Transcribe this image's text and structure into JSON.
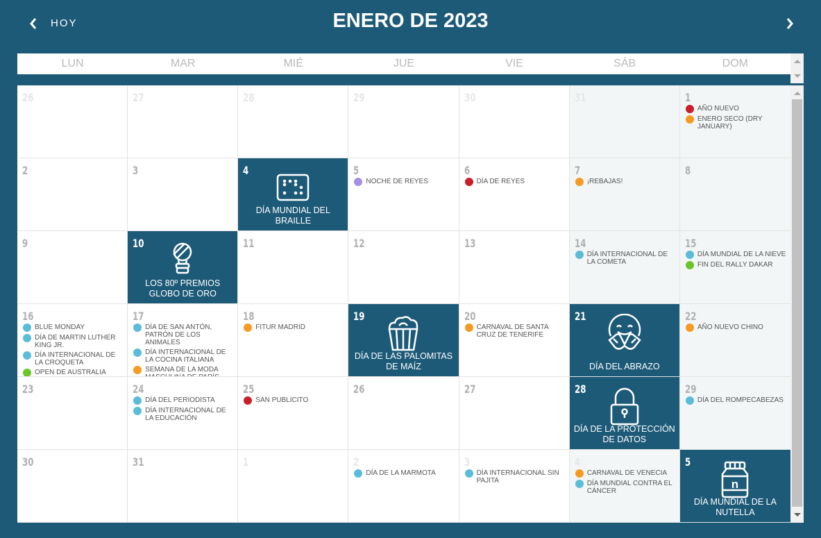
{
  "header": {
    "today_label": "HOY",
    "month_title": "ENERO DE 2023",
    "prev_icon": "chevron-left-icon",
    "next_icon": "chevron-right-icon"
  },
  "colors": {
    "brand": "#1d5a78",
    "red": "#c8202a",
    "orange": "#f59b23",
    "blue": "#5bbcd8",
    "green": "#6cc42b",
    "purple": "#a68fe3"
  },
  "weekdays": [
    "LUN",
    "MAR",
    "MIÉ",
    "JUE",
    "VIE",
    "SÁB",
    "DOM"
  ],
  "days": [
    {
      "num": "26",
      "other": true,
      "events": []
    },
    {
      "num": "27",
      "other": true,
      "events": []
    },
    {
      "num": "28",
      "other": true,
      "events": []
    },
    {
      "num": "29",
      "other": true,
      "events": []
    },
    {
      "num": "30",
      "other": true,
      "events": []
    },
    {
      "num": "31",
      "other": true,
      "weekend": true,
      "events": []
    },
    {
      "num": "1",
      "weekend": true,
      "events": [
        {
          "label": "AÑO NUEVO",
          "color": "red"
        },
        {
          "label": "ENERO SECO (DRY JANUARY)",
          "color": "orange"
        }
      ]
    },
    {
      "num": "2",
      "events": []
    },
    {
      "num": "3",
      "events": []
    },
    {
      "num": "4",
      "featured": {
        "label": "DÍA MUNDIAL DEL BRAILLE",
        "icon": "braille-icon"
      },
      "events": []
    },
    {
      "num": "5",
      "events": [
        {
          "label": "NOCHE DE REYES",
          "color": "purple"
        }
      ]
    },
    {
      "num": "6",
      "events": [
        {
          "label": "DÍA DE REYES",
          "color": "red"
        }
      ]
    },
    {
      "num": "7",
      "weekend": true,
      "events": [
        {
          "label": "¡REBAJAS!",
          "color": "orange"
        }
      ]
    },
    {
      "num": "8",
      "weekend": true,
      "events": []
    },
    {
      "num": "9",
      "events": []
    },
    {
      "num": "10",
      "featured": {
        "label": "LOS 80º PREMIOS GLOBO DE ORO",
        "icon": "golden-globe-icon"
      },
      "events": []
    },
    {
      "num": "11",
      "events": []
    },
    {
      "num": "12",
      "events": []
    },
    {
      "num": "13",
      "events": []
    },
    {
      "num": "14",
      "weekend": true,
      "events": [
        {
          "label": "DÍA INTERNACIONAL DE LA COMETA",
          "color": "blue"
        }
      ]
    },
    {
      "num": "15",
      "weekend": true,
      "events": [
        {
          "label": "DÍA MUNDIAL DE LA NIEVE",
          "color": "blue"
        },
        {
          "label": "FIN DEL RALLY DAKAR",
          "color": "green"
        }
      ]
    },
    {
      "num": "16",
      "events": [
        {
          "label": "BLUE MONDAY",
          "color": "blue"
        },
        {
          "label": "DÍA DE MARTIN LUTHER KING JR.",
          "color": "blue"
        },
        {
          "label": "DÍA INTERNACIONAL DE LA CROQUETA",
          "color": "blue"
        },
        {
          "label": "OPEN DE AUSTRALIA",
          "color": "green"
        }
      ]
    },
    {
      "num": "17",
      "events": [
        {
          "label": "DÍA DE SAN ANTÓN, PATRÓN DE LOS ANIMALES",
          "color": "blue"
        },
        {
          "label": "DÍA INTERNACIONAL DE LA COCINA ITALIANA",
          "color": "blue"
        },
        {
          "label": "SEMANA DE LA MODA MASCULINA DE PARÍS",
          "color": "orange"
        }
      ]
    },
    {
      "num": "18",
      "events": [
        {
          "label": "FITUR MADRID",
          "color": "orange"
        }
      ]
    },
    {
      "num": "19",
      "featured": {
        "label": "DÍA DE LAS PALOMITAS DE MAÍZ",
        "icon": "popcorn-icon"
      },
      "events": []
    },
    {
      "num": "20",
      "events": [
        {
          "label": "CARNAVAL DE SANTA CRUZ DE TENERIFE",
          "color": "orange"
        }
      ]
    },
    {
      "num": "21",
      "featured": {
        "label": "DÍA DEL ABRAZO",
        "icon": "hug-emoji-icon"
      },
      "events": []
    },
    {
      "num": "22",
      "weekend": true,
      "events": [
        {
          "label": "AÑO NUEVO CHINO",
          "color": "orange"
        }
      ]
    },
    {
      "num": "23",
      "events": []
    },
    {
      "num": "24",
      "events": [
        {
          "label": "DÍA DEL PERIODISTA",
          "color": "blue"
        },
        {
          "label": "DÍA INTERNACIONAL DE LA EDUCACIÓN",
          "color": "blue"
        }
      ]
    },
    {
      "num": "25",
      "events": [
        {
          "label": "SAN PUBLICITO",
          "color": "red"
        }
      ]
    },
    {
      "num": "26",
      "events": []
    },
    {
      "num": "27",
      "events": []
    },
    {
      "num": "28",
      "featured": {
        "label": "DÍA DE LA PROTECCIÓN DE DATOS",
        "icon": "padlock-icon"
      },
      "events": []
    },
    {
      "num": "29",
      "weekend": true,
      "events": [
        {
          "label": "DÍA DEL ROMPECABEZAS",
          "color": "blue"
        }
      ]
    },
    {
      "num": "30",
      "events": []
    },
    {
      "num": "31",
      "events": []
    },
    {
      "num": "1",
      "other": true,
      "events": []
    },
    {
      "num": "2",
      "other": true,
      "events": [
        {
          "label": "DÍA DE LA MARMOTA",
          "color": "blue"
        }
      ]
    },
    {
      "num": "3",
      "other": true,
      "events": [
        {
          "label": "DÍA INTERNACIONAL SIN PAJITA",
          "color": "blue"
        }
      ]
    },
    {
      "num": "4",
      "other": true,
      "weekend": true,
      "events": [
        {
          "label": "CARNAVAL DE VENECIA",
          "color": "orange"
        },
        {
          "label": "DÍA MUNDIAL CONTRA EL CÁNCER",
          "color": "blue"
        }
      ]
    },
    {
      "num": "5",
      "featured": {
        "label": "DÍA MUNDIAL DE LA NUTELLA",
        "icon": "nutella-jar-icon"
      },
      "events": []
    }
  ]
}
